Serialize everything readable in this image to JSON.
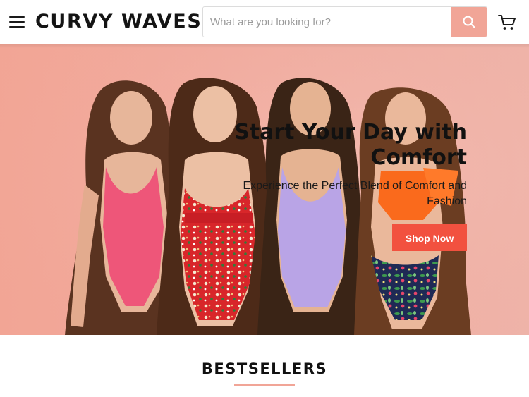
{
  "brand": {
    "name": "CURVY WAVES",
    "accent_color": "#f1a597",
    "button_color": "#f2513f"
  },
  "header": {
    "menu_icon": "hamburger-menu-icon",
    "search": {
      "placeholder": "What are you looking for?",
      "value": "",
      "button_icon": "search-icon"
    },
    "cart_icon": "cart-icon"
  },
  "hero": {
    "title": "Start Your Day with Comfort",
    "subtitle": "Experience the Perfect Blend of Comfort and Fashion",
    "cta_label": "Shop Now",
    "image_subject": "four women in swimsuits"
  },
  "section": {
    "title": "BESTSELLERS"
  }
}
